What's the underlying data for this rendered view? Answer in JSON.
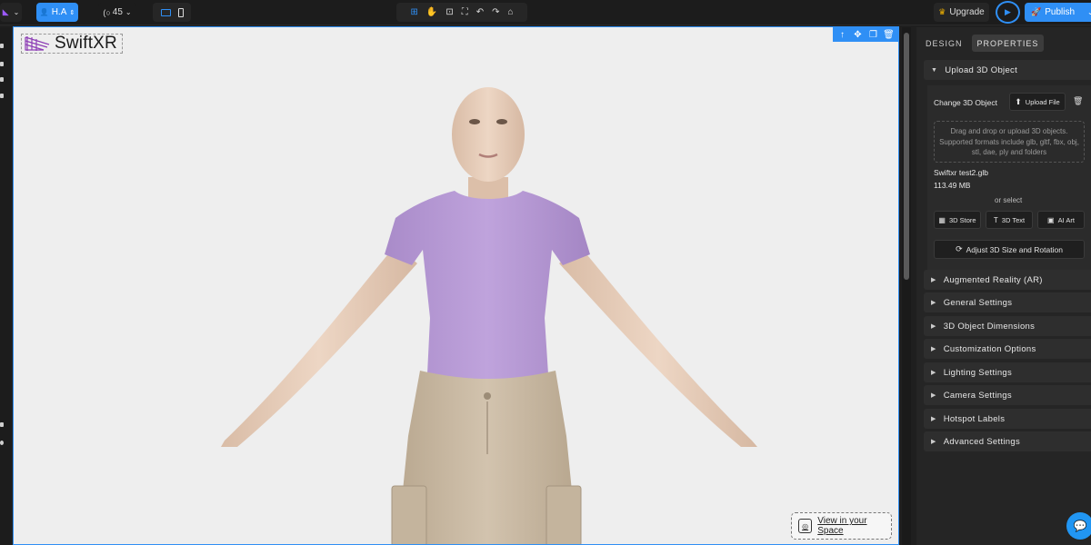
{
  "topbar": {
    "user_label": "H.A",
    "zoom_value": "45",
    "upgrade_label": "Upgrade",
    "publish_label": "Publish"
  },
  "canvas": {
    "logo_text": "SwiftXR",
    "view_in_space_label": "View in your Space"
  },
  "panel": {
    "tabs": [
      "DESIGN",
      "PROPERTIES"
    ],
    "upload_section_title": "Upload 3D Object",
    "change_label": "Change 3D Object",
    "upload_file_label": "Upload File",
    "dropzone_text": "Drag and drop or upload 3D objects. Supported formats include glb, gltf, fbx, obj, stl, dae, ply and folders",
    "file_name": "Swiftxr test2.glb",
    "file_size": "113.49 MB",
    "or_select": "or select",
    "store_label": "3D Store",
    "text_label": "3D Text",
    "ai_label": "AI Art",
    "adjust_label": "Adjust 3D Size and Rotation",
    "sections": [
      "Augmented Reality (AR)",
      "General Settings",
      "3D Object Dimensions",
      "Customization Options",
      "Lighting Settings",
      "Camera Settings",
      "Hotspot Labels",
      "Advanced Settings"
    ]
  },
  "colors": {
    "accent": "#2f8ff5",
    "canvas_bg": "#eeeeee",
    "panel_bg": "#252525"
  }
}
